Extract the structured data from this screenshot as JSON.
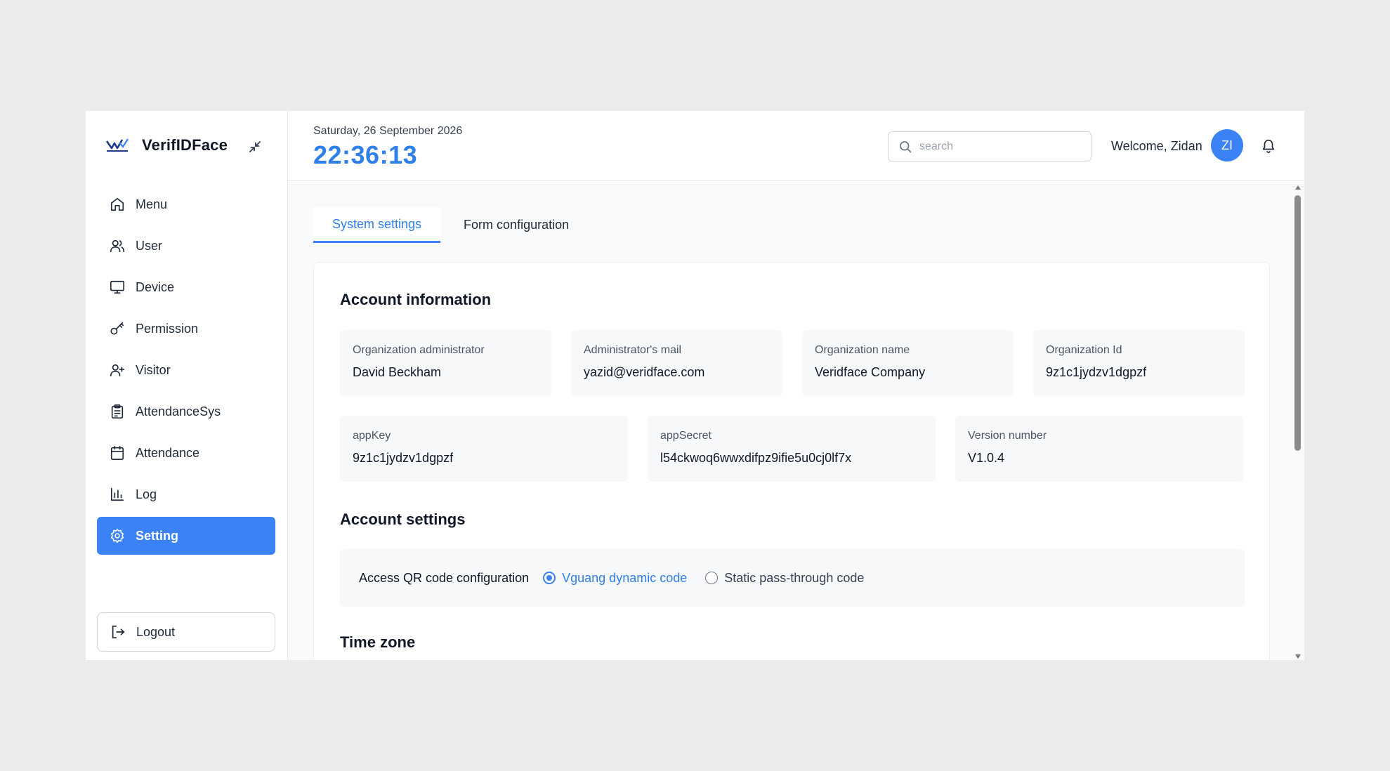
{
  "app": {
    "name": "VerifIDFace"
  },
  "sidebar": {
    "items": [
      {
        "label": "Menu",
        "icon": "home-icon",
        "active": false
      },
      {
        "label": "User",
        "icon": "users-icon",
        "active": false
      },
      {
        "label": "Device",
        "icon": "monitor-icon",
        "active": false
      },
      {
        "label": "Permission",
        "icon": "key-icon",
        "active": false
      },
      {
        "label": "Visitor",
        "icon": "user-plus-icon",
        "active": false
      },
      {
        "label": "AttendanceSys",
        "icon": "clipboard-icon",
        "active": false
      },
      {
        "label": "Attendance",
        "icon": "calendar-icon",
        "active": false
      },
      {
        "label": "Log",
        "icon": "bar-chart-icon",
        "active": false
      },
      {
        "label": "Setting",
        "icon": "gear-icon",
        "active": true
      }
    ],
    "logout_label": "Logout"
  },
  "header": {
    "date": "Saturday, 26 September 2026",
    "time": "22:36:13",
    "search_placeholder": "search",
    "welcome": "Welcome, Zidan",
    "avatar_initials": "ZI"
  },
  "tabs": [
    {
      "label": "System settings",
      "active": true
    },
    {
      "label": "Form configuration",
      "active": false
    }
  ],
  "account_information": {
    "title": "Account information",
    "row1": [
      {
        "label": "Organization administrator",
        "value": "David Beckham"
      },
      {
        "label": "Administrator's mail",
        "value": "yazid@veridface.com"
      },
      {
        "label": "Organization name",
        "value": "Veridface Company"
      },
      {
        "label": "Organization Id",
        "value": "9z1c1jydzv1dgpzf"
      }
    ],
    "row2": [
      {
        "label": "appKey",
        "value": "9z1c1jydzv1dgpzf"
      },
      {
        "label": "appSecret",
        "value": "l54ckwoq6wwxdifpz9ifie5u0cj0lf7x"
      },
      {
        "label": "Version number",
        "value": "V1.0.4"
      }
    ]
  },
  "account_settings": {
    "title": "Account settings",
    "qr_label": "Access QR code configuration",
    "options": [
      {
        "label": "Vguang dynamic code",
        "checked": true
      },
      {
        "label": "Static pass-through code",
        "checked": false
      }
    ]
  },
  "time_zone": {
    "title": "Time zone"
  },
  "colors": {
    "accent": "#3b82f6",
    "clock": "#2f7fe8",
    "background": "#ececec"
  }
}
